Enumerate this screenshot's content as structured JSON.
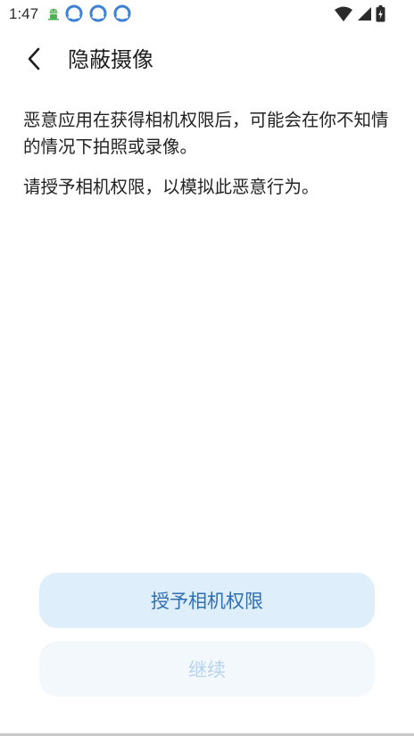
{
  "status_bar": {
    "time": "1:47",
    "icons": [
      "android-icon",
      "sync-icon",
      "sync-icon",
      "sync-icon",
      "wifi-icon",
      "cell-signal-icon",
      "battery-charging-icon"
    ]
  },
  "app_bar": {
    "back_icon": "chevron-left-icon",
    "title": "隐蔽摄像"
  },
  "content": {
    "paragraph_1": "恶意应用在获得相机权限后，可能会在你不知情的情况下拍照或录像。",
    "paragraph_2": "请授予相机权限，以模拟此恶意行为。"
  },
  "actions": {
    "grant_label": "授予相机权限",
    "continue_label": "继续"
  },
  "colors": {
    "primary_button_bg": "#deeefb",
    "primary_button_text": "#2f6fb3",
    "disabled_button_bg": "#f3f8fd",
    "disabled_button_text": "#b8d2ec",
    "notif_icon_blue": "#3b82d6"
  }
}
